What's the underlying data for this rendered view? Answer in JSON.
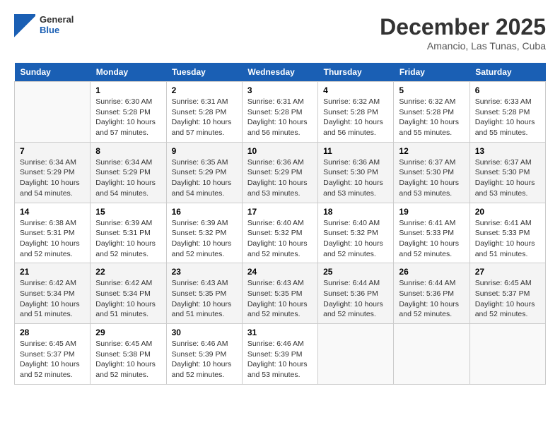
{
  "header": {
    "logo_line1": "General",
    "logo_line2": "Blue",
    "month": "December 2025",
    "location": "Amancio, Las Tunas, Cuba"
  },
  "weekdays": [
    "Sunday",
    "Monday",
    "Tuesday",
    "Wednesday",
    "Thursday",
    "Friday",
    "Saturday"
  ],
  "weeks": [
    [
      {
        "day": "",
        "info": ""
      },
      {
        "day": "1",
        "info": "Sunrise: 6:30 AM\nSunset: 5:28 PM\nDaylight: 10 hours\nand 57 minutes."
      },
      {
        "day": "2",
        "info": "Sunrise: 6:31 AM\nSunset: 5:28 PM\nDaylight: 10 hours\nand 57 minutes."
      },
      {
        "day": "3",
        "info": "Sunrise: 6:31 AM\nSunset: 5:28 PM\nDaylight: 10 hours\nand 56 minutes."
      },
      {
        "day": "4",
        "info": "Sunrise: 6:32 AM\nSunset: 5:28 PM\nDaylight: 10 hours\nand 56 minutes."
      },
      {
        "day": "5",
        "info": "Sunrise: 6:32 AM\nSunset: 5:28 PM\nDaylight: 10 hours\nand 55 minutes."
      },
      {
        "day": "6",
        "info": "Sunrise: 6:33 AM\nSunset: 5:28 PM\nDaylight: 10 hours\nand 55 minutes."
      }
    ],
    [
      {
        "day": "7",
        "info": "Sunrise: 6:34 AM\nSunset: 5:29 PM\nDaylight: 10 hours\nand 54 minutes."
      },
      {
        "day": "8",
        "info": "Sunrise: 6:34 AM\nSunset: 5:29 PM\nDaylight: 10 hours\nand 54 minutes."
      },
      {
        "day": "9",
        "info": "Sunrise: 6:35 AM\nSunset: 5:29 PM\nDaylight: 10 hours\nand 54 minutes."
      },
      {
        "day": "10",
        "info": "Sunrise: 6:36 AM\nSunset: 5:29 PM\nDaylight: 10 hours\nand 53 minutes."
      },
      {
        "day": "11",
        "info": "Sunrise: 6:36 AM\nSunset: 5:30 PM\nDaylight: 10 hours\nand 53 minutes."
      },
      {
        "day": "12",
        "info": "Sunrise: 6:37 AM\nSunset: 5:30 PM\nDaylight: 10 hours\nand 53 minutes."
      },
      {
        "day": "13",
        "info": "Sunrise: 6:37 AM\nSunset: 5:30 PM\nDaylight: 10 hours\nand 53 minutes."
      }
    ],
    [
      {
        "day": "14",
        "info": "Sunrise: 6:38 AM\nSunset: 5:31 PM\nDaylight: 10 hours\nand 52 minutes."
      },
      {
        "day": "15",
        "info": "Sunrise: 6:39 AM\nSunset: 5:31 PM\nDaylight: 10 hours\nand 52 minutes."
      },
      {
        "day": "16",
        "info": "Sunrise: 6:39 AM\nSunset: 5:32 PM\nDaylight: 10 hours\nand 52 minutes."
      },
      {
        "day": "17",
        "info": "Sunrise: 6:40 AM\nSunset: 5:32 PM\nDaylight: 10 hours\nand 52 minutes."
      },
      {
        "day": "18",
        "info": "Sunrise: 6:40 AM\nSunset: 5:32 PM\nDaylight: 10 hours\nand 52 minutes."
      },
      {
        "day": "19",
        "info": "Sunrise: 6:41 AM\nSunset: 5:33 PM\nDaylight: 10 hours\nand 52 minutes."
      },
      {
        "day": "20",
        "info": "Sunrise: 6:41 AM\nSunset: 5:33 PM\nDaylight: 10 hours\nand 51 minutes."
      }
    ],
    [
      {
        "day": "21",
        "info": "Sunrise: 6:42 AM\nSunset: 5:34 PM\nDaylight: 10 hours\nand 51 minutes."
      },
      {
        "day": "22",
        "info": "Sunrise: 6:42 AM\nSunset: 5:34 PM\nDaylight: 10 hours\nand 51 minutes."
      },
      {
        "day": "23",
        "info": "Sunrise: 6:43 AM\nSunset: 5:35 PM\nDaylight: 10 hours\nand 51 minutes."
      },
      {
        "day": "24",
        "info": "Sunrise: 6:43 AM\nSunset: 5:35 PM\nDaylight: 10 hours\nand 52 minutes."
      },
      {
        "day": "25",
        "info": "Sunrise: 6:44 AM\nSunset: 5:36 PM\nDaylight: 10 hours\nand 52 minutes."
      },
      {
        "day": "26",
        "info": "Sunrise: 6:44 AM\nSunset: 5:36 PM\nDaylight: 10 hours\nand 52 minutes."
      },
      {
        "day": "27",
        "info": "Sunrise: 6:45 AM\nSunset: 5:37 PM\nDaylight: 10 hours\nand 52 minutes."
      }
    ],
    [
      {
        "day": "28",
        "info": "Sunrise: 6:45 AM\nSunset: 5:37 PM\nDaylight: 10 hours\nand 52 minutes."
      },
      {
        "day": "29",
        "info": "Sunrise: 6:45 AM\nSunset: 5:38 PM\nDaylight: 10 hours\nand 52 minutes."
      },
      {
        "day": "30",
        "info": "Sunrise: 6:46 AM\nSunset: 5:39 PM\nDaylight: 10 hours\nand 52 minutes."
      },
      {
        "day": "31",
        "info": "Sunrise: 6:46 AM\nSunset: 5:39 PM\nDaylight: 10 hours\nand 53 minutes."
      },
      {
        "day": "",
        "info": ""
      },
      {
        "day": "",
        "info": ""
      },
      {
        "day": "",
        "info": ""
      }
    ]
  ]
}
